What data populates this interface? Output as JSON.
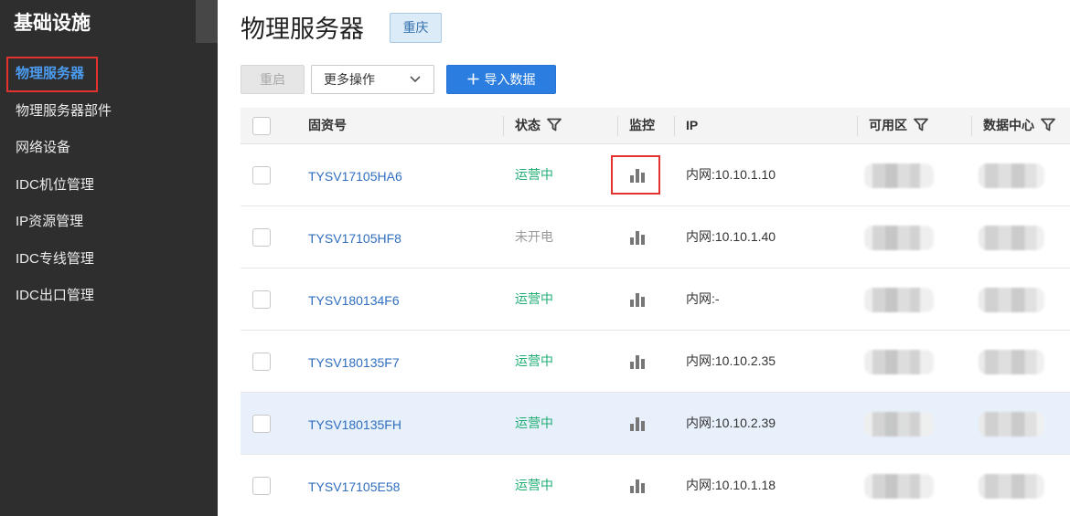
{
  "sidebar": {
    "title": "基础设施",
    "items": [
      {
        "label": "物理服务器",
        "active": true
      },
      {
        "label": "物理服务器部件",
        "active": false
      },
      {
        "label": "网络设备",
        "active": false
      },
      {
        "label": "IDC机位管理",
        "active": false
      },
      {
        "label": "IP资源管理",
        "active": false
      },
      {
        "label": "IDC专线管理",
        "active": false
      },
      {
        "label": "IDC出口管理",
        "active": false
      }
    ]
  },
  "page": {
    "title": "物理服务器",
    "region_badge": "重庆"
  },
  "toolbar": {
    "restart_label": "重启",
    "restart_disabled": true,
    "more_actions_label": "更多操作",
    "import_label": "导入数据"
  },
  "table": {
    "columns": {
      "asset_id": "固资号",
      "status": "状态",
      "monitor": "监控",
      "ip": "IP",
      "zone": "可用区",
      "datacenter": "数据中心"
    },
    "rows": [
      {
        "asset_id": "TYSV17105HA6",
        "status": "运营中",
        "status_color": "#1fae74",
        "ip": "内网:10.10.1.10",
        "highlighted": false
      },
      {
        "asset_id": "TYSV17105HF8",
        "status": "未开电",
        "status_color": "#999999",
        "ip": "内网:10.10.1.40",
        "highlighted": false
      },
      {
        "asset_id": "TYSV180134F6",
        "status": "运营中",
        "status_color": "#1fae74",
        "ip": "内网:-",
        "highlighted": false
      },
      {
        "asset_id": "TYSV180135F7",
        "status": "运营中",
        "status_color": "#1fae74",
        "ip": "内网:10.10.2.35",
        "highlighted": false
      },
      {
        "asset_id": "TYSV180135FH",
        "status": "运营中",
        "status_color": "#1fae74",
        "ip": "内网:10.10.2.39",
        "highlighted": true
      },
      {
        "asset_id": "TYSV17105E58",
        "status": "运营中",
        "status_color": "#1fae74",
        "ip": "内网:10.10.1.18",
        "highlighted": false
      }
    ]
  },
  "icons": {
    "filter": "filter-icon",
    "monitor": "bar-chart-icon",
    "dropdown": "chevron-down-icon",
    "import": "plus-icon"
  },
  "colors": {
    "sidebar_bg": "#2e2e2e",
    "sidebar_active": "#4b9cf0",
    "primary": "#2b7de0",
    "link": "#2f6ec0",
    "row_highlight": "#e8f0fb",
    "annotation": "#e3332f"
  }
}
